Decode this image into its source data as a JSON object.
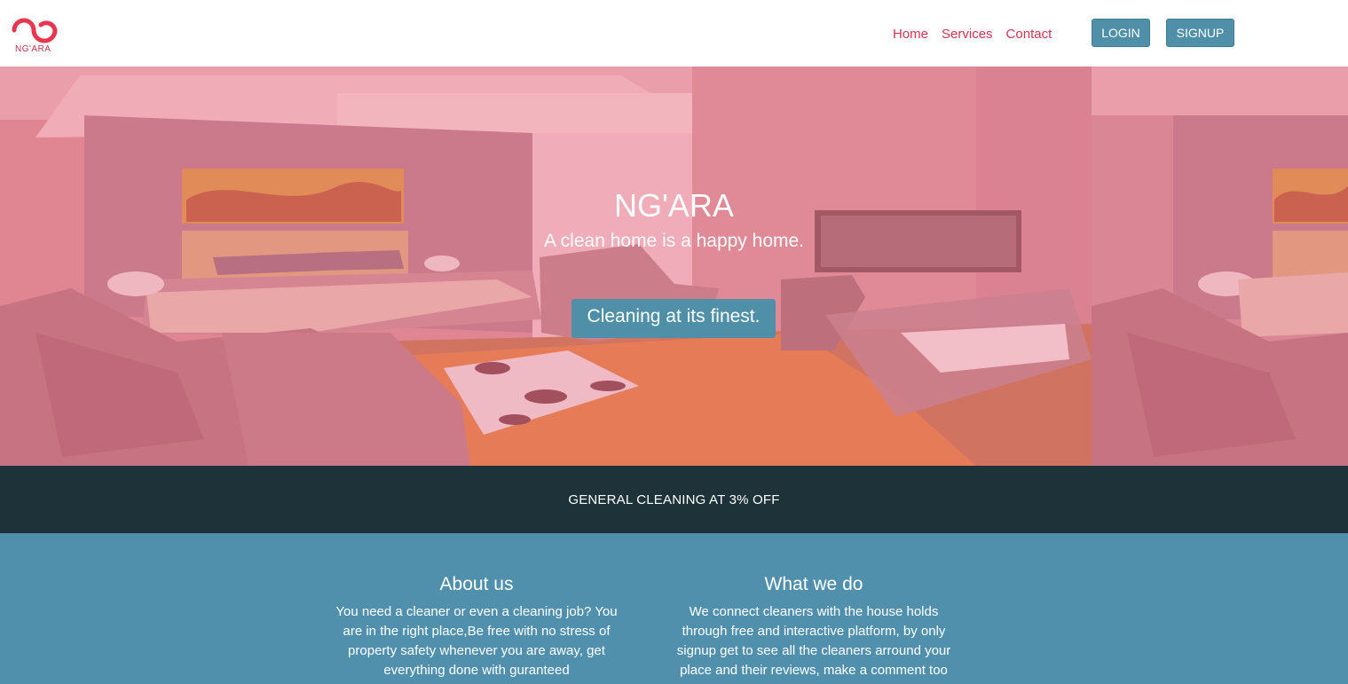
{
  "brand": {
    "logo_text": "NG'ARA",
    "accent": "#d6334f"
  },
  "nav": {
    "links": [
      {
        "label": "Home"
      },
      {
        "label": "Services"
      },
      {
        "label": "Contact"
      }
    ],
    "login_label": "LOGIN",
    "signup_label": "SIGNUP",
    "button_color": "#4f8fa8"
  },
  "hero": {
    "title": "NG'ARA",
    "subtitle": "A clean home is a happy home.",
    "cta_label": "Cleaning at its finest."
  },
  "promo": {
    "text": "GENERAL CLEANING AT 3% OFF",
    "background": "#1e3239"
  },
  "info": {
    "background": "#5190ac",
    "about": {
      "heading": "About us",
      "body": "You need a cleaner or even a cleaning job? You are in the right place,Be free with no stress of property safety whenever you are away, get everything done with guranteed"
    },
    "what": {
      "heading": "What we do",
      "body": "We connect cleaners with the house holds through free and interactive platform, by only signup get to see all the cleaners arround your place and their reviews, make a comment too"
    }
  }
}
